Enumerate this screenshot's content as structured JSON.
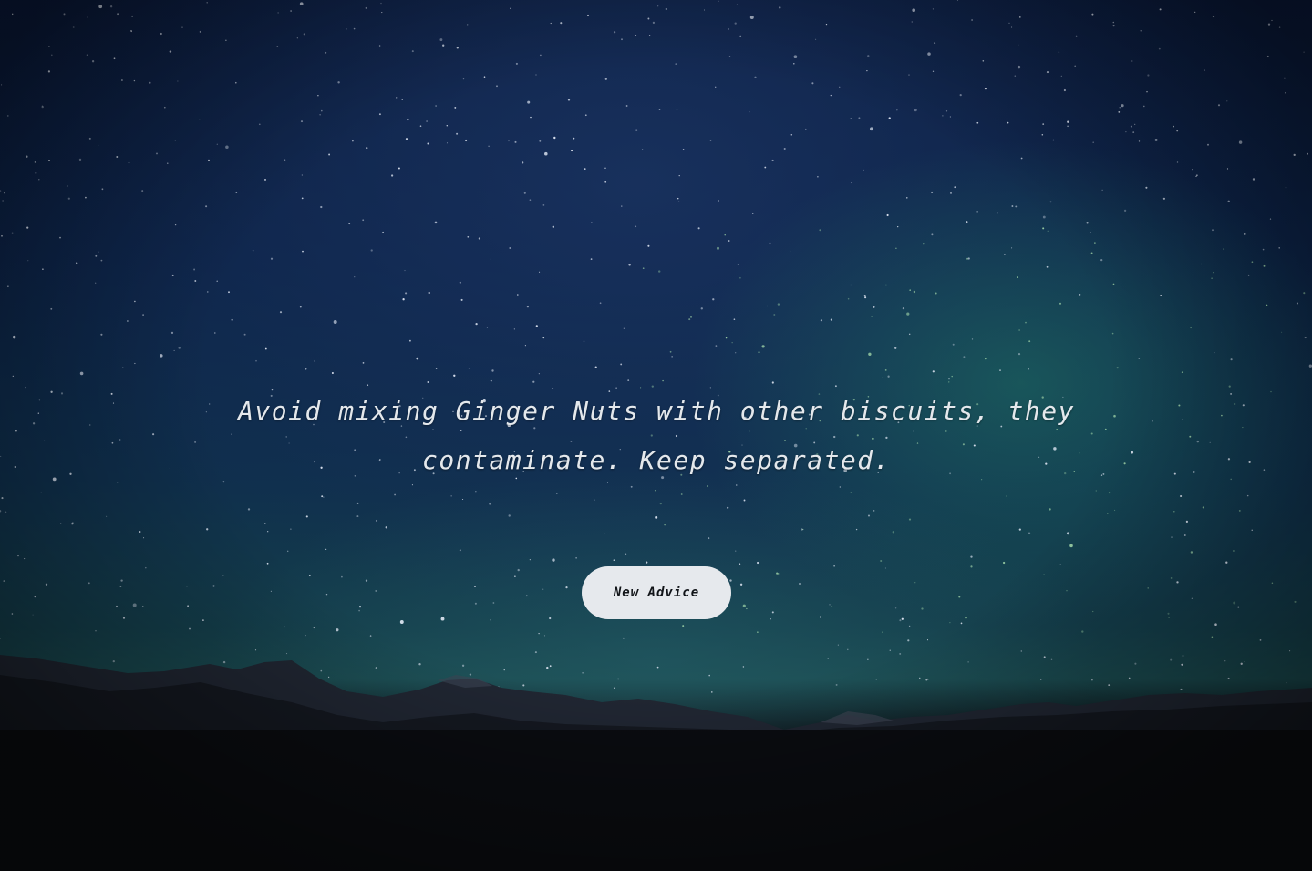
{
  "advice": {
    "text": "Avoid mixing Ginger Nuts with other biscuits, they contaminate. Keep separated."
  },
  "button": {
    "label": "New Advice"
  },
  "colors": {
    "text": "#e4e8ec",
    "button_bg": "#e6e9ed",
    "button_text": "#111418",
    "sky_top": "#0a1a3c",
    "sky_glow": "#207864"
  }
}
